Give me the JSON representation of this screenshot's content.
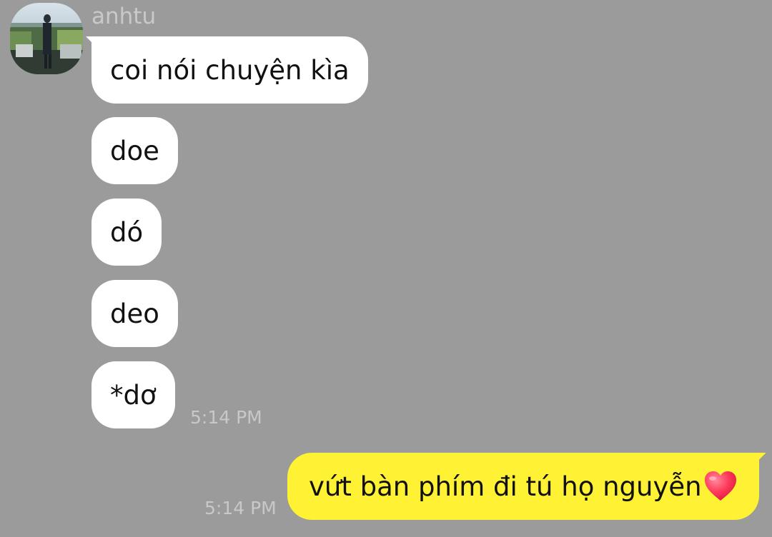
{
  "chat": {
    "sender": {
      "name": "anhtu",
      "avatar_icon": "user-avatar-photo"
    },
    "incoming_messages": [
      {
        "text": "coi nói chuyện kìa"
      },
      {
        "text": "doe"
      },
      {
        "text": "dó"
      },
      {
        "text": "deo"
      },
      {
        "text": "*dơ"
      }
    ],
    "incoming_time": "5:14 PM",
    "outgoing_message": {
      "text": "vứt bàn phím đi tú họ nguyễn",
      "emoji": "heart-icon"
    },
    "outgoing_time": "5:14 PM"
  },
  "colors": {
    "background": "#9b9b9b",
    "incoming_bubble": "#ffffff",
    "outgoing_bubble": "#fff133",
    "timestamp": "#c8c8c8",
    "heart": "#ff3b5c"
  }
}
